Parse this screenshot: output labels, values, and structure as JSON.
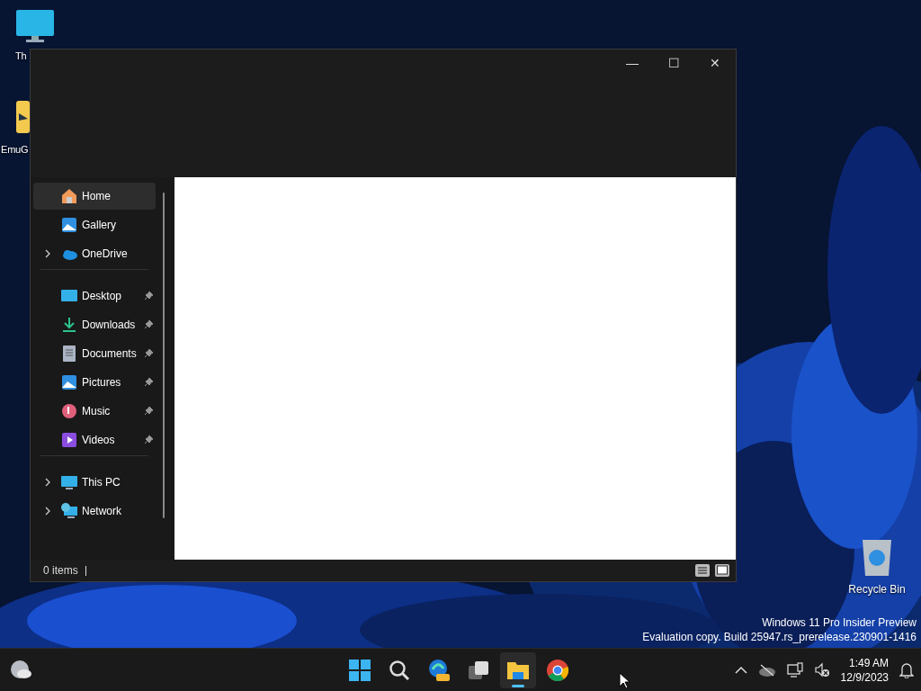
{
  "desktop_icons": [
    {
      "label": "Th"
    },
    {
      "label": "EmuG"
    },
    {
      "label": "Recycle Bin"
    }
  ],
  "window": {
    "controls": [
      "—",
      "☐",
      "✕"
    ],
    "sidebar": {
      "groups": [
        {
          "items": [
            {
              "label": "Home",
              "selected": true
            },
            {
              "label": "Gallery",
              "selected": false
            },
            {
              "label": "OneDrive",
              "selected": false,
              "expanded": false
            }
          ]
        },
        {
          "items": [
            {
              "label": "Desktop",
              "selected": false,
              "pinned": true
            },
            {
              "label": "Downloads",
              "selected": false,
              "pinned": true
            },
            {
              "label": "Documents",
              "selected": false,
              "pinned": true
            },
            {
              "label": "Pictures",
              "selected": false,
              "pinned": true
            },
            {
              "label": "Music",
              "selected": false,
              "pinned": true
            },
            {
              "label": "Videos",
              "selected": false,
              "pinned": true
            }
          ]
        },
        {
          "items": [
            {
              "label": "This PC",
              "selected": false,
              "expanded": false
            },
            {
              "label": "Network",
              "selected": false,
              "expanded": false
            }
          ]
        }
      ]
    },
    "status_bar": {
      "count": "0 items"
    }
  },
  "os_notice": [
    "Windows 11 Pro Insider Preview",
    "Evaluation copy. Build 25947.rs_prerelease.230901-1416"
  ],
  "taskbar": {
    "apps": [
      {
        "selected": false
      },
      {
        "selected": false
      },
      {
        "selected": false
      },
      {
        "selected": false
      },
      {
        "selected": true
      },
      {
        "selected": false
      }
    ],
    "tray": {
      "time": "1:49 AM",
      "date": "12/9/2023"
    }
  }
}
